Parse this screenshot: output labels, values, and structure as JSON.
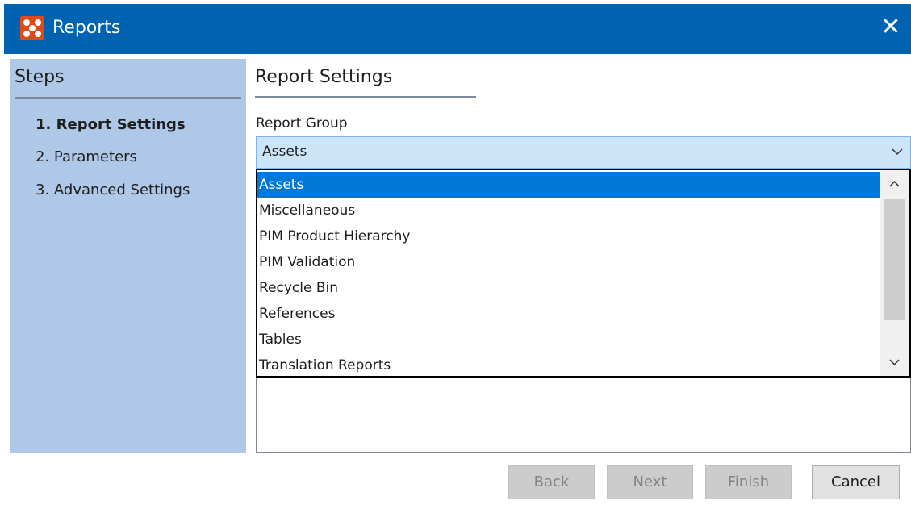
{
  "window": {
    "title": "Reports",
    "close_glyph": "✕",
    "colors": {
      "titlebar": "#0063b1",
      "app_icon": "#e04a16"
    }
  },
  "steps": {
    "header": "Steps",
    "items": [
      {
        "label": "1. Report Settings",
        "active": true
      },
      {
        "label": "2. Parameters",
        "active": false
      },
      {
        "label": "3. Advanced Settings",
        "active": false
      }
    ]
  },
  "main": {
    "section_title": "Report Settings",
    "field_label": "Report Group",
    "combo_value": "Assets",
    "options": [
      "Assets",
      "Miscellaneous",
      "PIM Product Hierarchy",
      "PIM Validation",
      "Recycle Bin",
      "References",
      "Tables",
      "Translation Reports"
    ],
    "selected_option": "Assets"
  },
  "footer": {
    "back_label": "Back",
    "next_label": "Next",
    "finish_label": "Finish",
    "cancel_label": "Cancel"
  }
}
